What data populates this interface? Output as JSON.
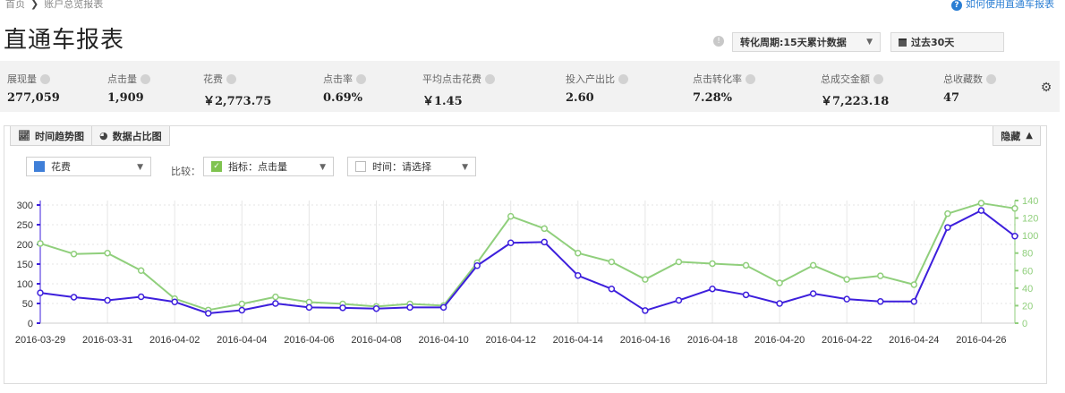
{
  "breadcrumb": {
    "home": "首页",
    "sep": "❯",
    "current": "账户总览报表"
  },
  "help_link": "如何使用直通车报表",
  "page_title": "直通车报表",
  "conversion_period": "转化周期:15天累计数据",
  "date_range": "过去30天",
  "metrics": [
    {
      "label": "展现量",
      "value": "277,059"
    },
    {
      "label": "点击量",
      "value": "1,909"
    },
    {
      "label": "花费",
      "value": "￥2,773.75"
    },
    {
      "label": "点击率",
      "value": "0.69%"
    },
    {
      "label": "平均点击花费",
      "value": "￥1.45"
    },
    {
      "label": "投入产出比",
      "value": "2.60"
    },
    {
      "label": "点击转化率",
      "value": "7.28%"
    },
    {
      "label": "总成交金额",
      "value": "￥7,223.18"
    },
    {
      "label": "总收藏数",
      "value": "47"
    }
  ],
  "tabs": {
    "trend": "时间趋势图",
    "share": "数据占比图"
  },
  "hide_button": "隐藏",
  "metric_select": "花费",
  "compare_label": "比较：",
  "compare_select": "指标：点击量",
  "time_select": "时间：请选择",
  "colors": {
    "primary_series": "#3d1fdc",
    "secondary_series": "#90cf7c"
  },
  "chart_data": {
    "type": "line",
    "x": [
      "2016-03-29",
      "2016-03-30",
      "2016-03-31",
      "2016-04-01",
      "2016-04-02",
      "2016-04-03",
      "2016-04-04",
      "2016-04-05",
      "2016-04-06",
      "2016-04-07",
      "2016-04-08",
      "2016-04-09",
      "2016-04-10",
      "2016-04-11",
      "2016-04-12",
      "2016-04-13",
      "2016-04-14",
      "2016-04-15",
      "2016-04-16",
      "2016-04-17",
      "2016-04-18",
      "2016-04-19",
      "2016-04-20",
      "2016-04-21",
      "2016-04-22",
      "2016-04-23",
      "2016-04-24",
      "2016-04-25",
      "2016-04-26",
      "2016-04-27"
    ],
    "x_tick_labels": [
      "2016-03-29",
      "2016-03-31",
      "2016-04-02",
      "2016-04-04",
      "2016-04-06",
      "2016-04-08",
      "2016-04-10",
      "2016-04-12",
      "2016-04-14",
      "2016-04-16",
      "2016-04-18",
      "2016-04-20",
      "2016-04-22",
      "2016-04-24",
      "2016-04-26"
    ],
    "y_left": {
      "min": 0,
      "max": 300,
      "ticks": [
        0,
        50,
        100,
        150,
        200,
        250,
        300
      ]
    },
    "y_right": {
      "min": 0,
      "max": 140,
      "ticks": [
        0,
        20,
        40,
        60,
        80,
        100,
        120,
        140
      ]
    },
    "series": [
      {
        "axis": "left",
        "values": [
          77,
          66,
          58,
          67,
          54,
          25,
          33,
          50,
          40,
          39,
          37,
          40,
          40,
          146,
          204,
          206,
          121,
          87,
          32,
          58,
          87,
          72,
          50,
          75,
          61,
          55,
          55,
          243,
          286,
          221
        ]
      },
      {
        "axis": "right",
        "values": [
          91,
          79,
          80,
          60,
          28,
          15,
          22,
          30,
          24,
          22,
          19,
          22,
          20,
          69,
          122,
          108,
          80,
          70,
          50,
          70,
          68,
          66,
          46,
          66,
          50,
          54,
          44,
          125,
          137,
          131
        ]
      }
    ],
    "grid": true
  }
}
